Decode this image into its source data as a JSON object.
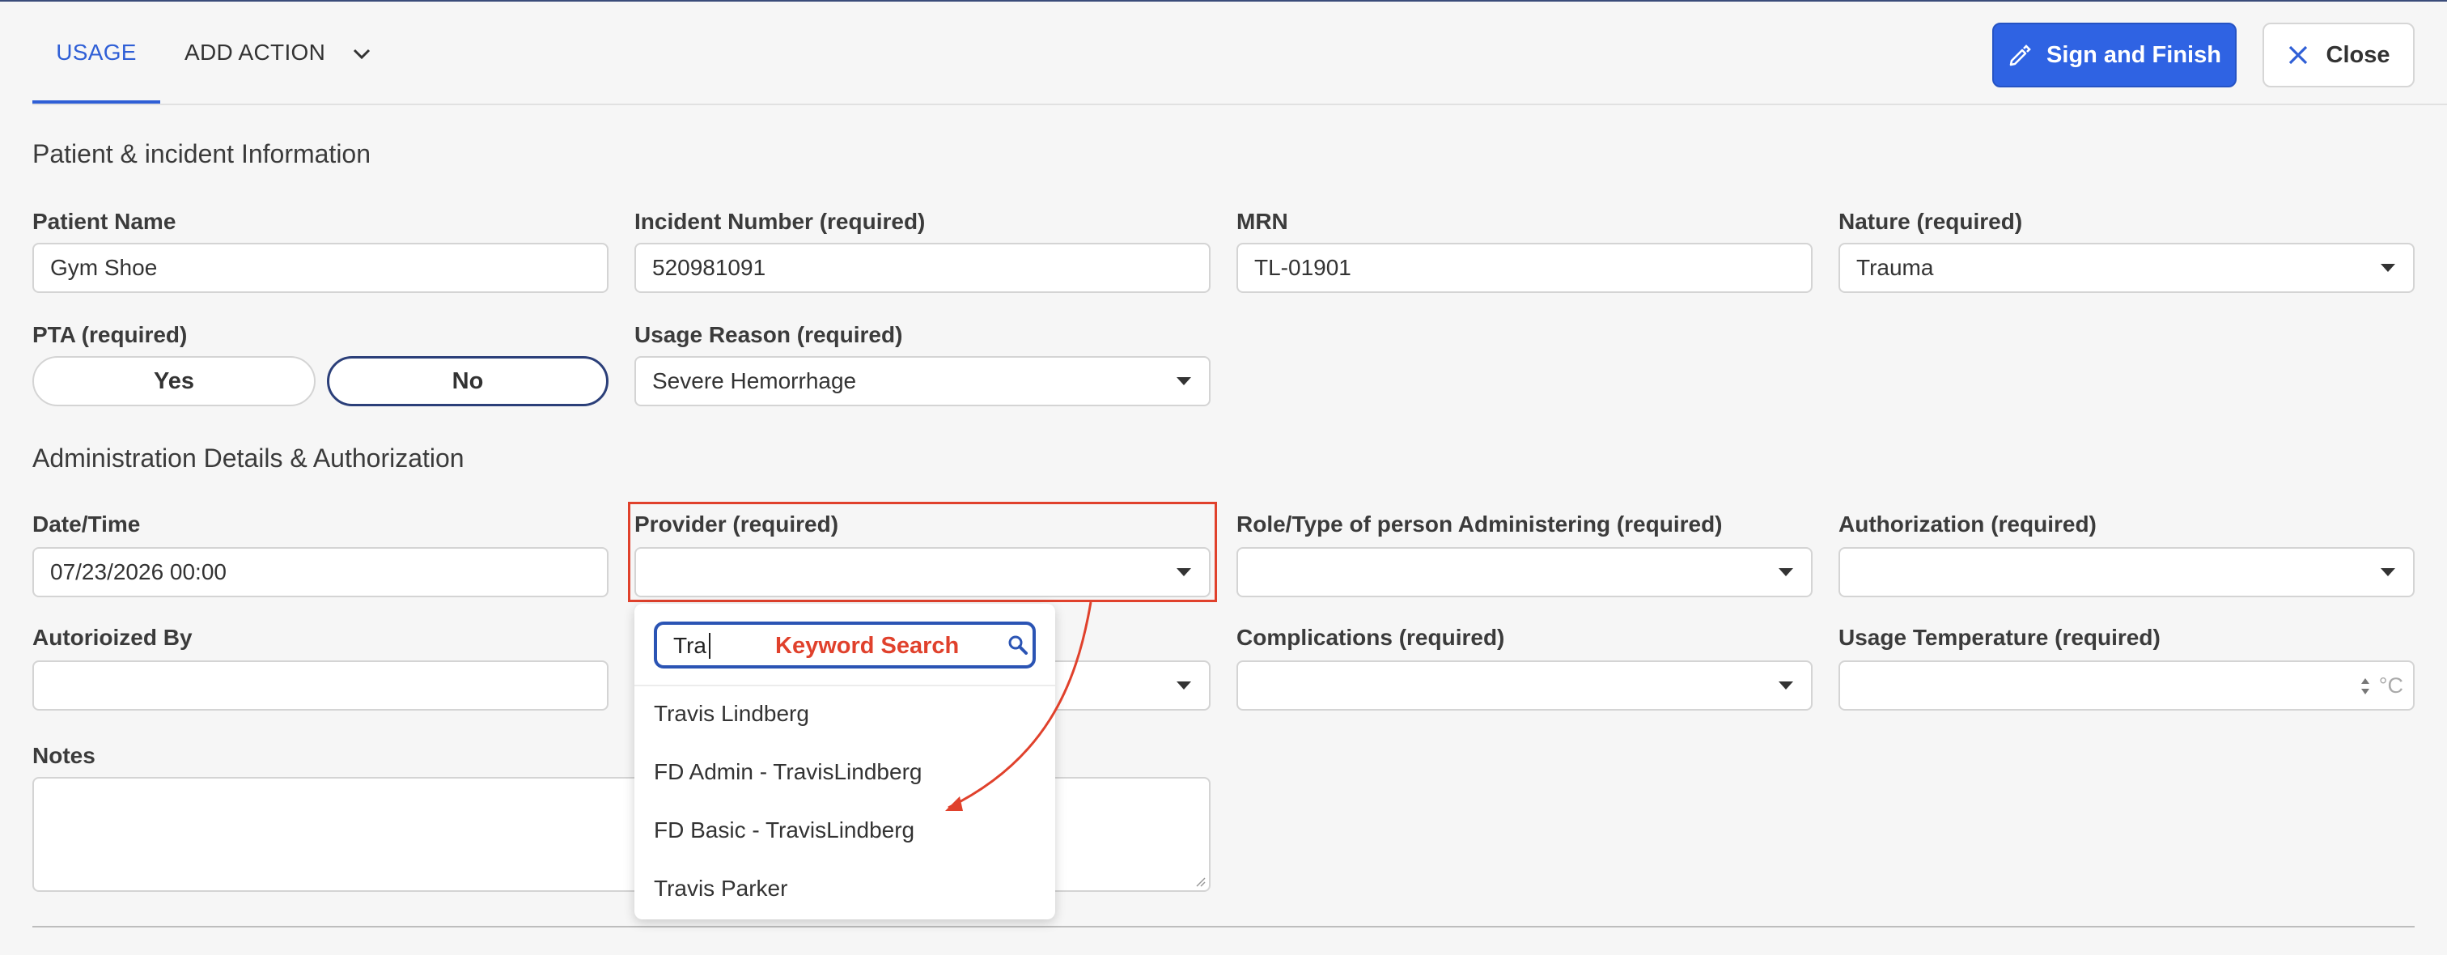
{
  "tabs": {
    "usage": "USAGE",
    "add_action": "ADD ACTION"
  },
  "buttons": {
    "sign_finish": "Sign and Finish",
    "close": "Close"
  },
  "sections": {
    "patient": "Patient & incident Information",
    "admin": "Administration Details & Authorization"
  },
  "fields": {
    "patient_name": {
      "label": "Patient Name",
      "value": "Gym Shoe"
    },
    "incident_number": {
      "label": "Incident Number (required)",
      "value": "520981091"
    },
    "mrn": {
      "label": "MRN",
      "value": "TL-01901"
    },
    "nature": {
      "label": "Nature (required)",
      "value": "Trauma"
    },
    "pta": {
      "label": "PTA (required)",
      "yes": "Yes",
      "no": "No",
      "selected": "No"
    },
    "usage_reason": {
      "label": "Usage Reason (required)",
      "value": "Severe Hemorrhage"
    },
    "datetime": {
      "label": "Date/Time",
      "value": "07/23/2026 00:00"
    },
    "provider": {
      "label": "Provider (required)",
      "value": ""
    },
    "role_type": {
      "label": "Role/Type of person Administering (required)",
      "value": ""
    },
    "authorization": {
      "label": "Authorization (required)",
      "value": ""
    },
    "authorized_by": {
      "label": "Autorioized By",
      "value": ""
    },
    "complications": {
      "label": "Complications (required)",
      "value": ""
    },
    "usage_temperature": {
      "label": "Usage Temperature (required)",
      "value": "",
      "unit": "°C"
    },
    "notes": {
      "label": "Notes",
      "value": ""
    }
  },
  "provider_dropdown": {
    "search_value": "Tra",
    "annotation": "Keyword Search",
    "options": [
      "Travis Lindberg",
      "FD Admin - TravisLindberg",
      "FD Basic - TravisLindberg",
      "Travis Parker"
    ]
  },
  "colors": {
    "accent": "#2f63e3",
    "annotation_red": "#e0412c",
    "selected_pill_border": "#2b3f79"
  }
}
